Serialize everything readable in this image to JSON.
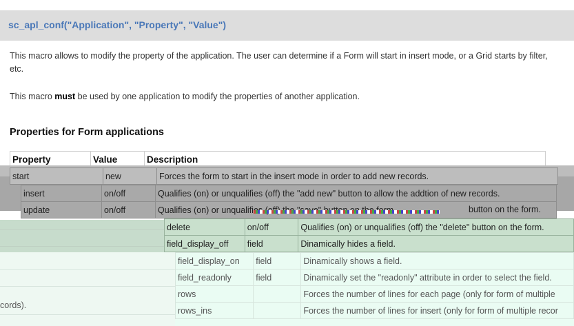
{
  "header": {
    "title": "sc_apl_conf(\"Application\", \"Property\", \"Value\")"
  },
  "intro": {
    "p1": "This macro allows to modify the property of the application. The user can determine if a Form will start in insert mode, or a Grid starts by filter, etc.",
    "p2_before": "This macro ",
    "p2_bold": "must",
    "p2_after": " be used by one application to modify the properties of another application."
  },
  "section": {
    "heading": "Properties for Form applications"
  },
  "table": {
    "headers": [
      "Property",
      "Value",
      "Description"
    ],
    "rows": [
      [
        "start",
        "new",
        "Forces the form to start in the insert mode in order to add new records."
      ],
      [
        "insert",
        "on/off",
        "Qualifies (on) or unqualifies (off) the \"add new\" button to allow the addtion of new records."
      ],
      [
        "update",
        "on/off",
        "Qualifies (on) or unqualifies (off) the \"save\" button on the form."
      ],
      [
        "delete",
        "on/off",
        "Qualifies (on) or unqualifies (off) the \"delete\" button on the form."
      ],
      [
        "field_display_off",
        "field",
        "Dinamically hides a field."
      ],
      [
        "field_display_on",
        "field",
        "Dinamically shows a field."
      ],
      [
        "field_readonly",
        "field",
        "Dinamically set the \"readonly\" attribute in order to select the field."
      ],
      [
        "rows",
        "",
        "Forces the number of lines for each page (only for form of multiple"
      ],
      [
        "rows_ins",
        "",
        "Forces the number of lines for insert (only for form of multiple recor"
      ]
    ],
    "overlap_fragment": "button on the form.",
    "left_fragment": "cords)."
  },
  "colors": {
    "title_bg": "#dddddd",
    "title_text": "#4a78b8",
    "glitch_gray": "#a7a7a7",
    "glitch_green": "#b7d4be",
    "glitch_mint": "#eafcf3"
  }
}
